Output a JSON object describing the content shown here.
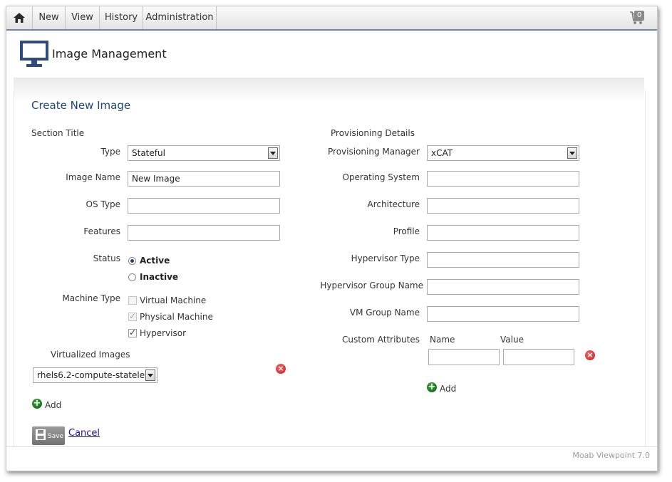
{
  "nav": {
    "items": [
      "New",
      "View",
      "History",
      "Administration"
    ],
    "cart_count": "0"
  },
  "header": {
    "title": "Image Management"
  },
  "form": {
    "title": "Create New Image",
    "left_section_title": "Section Title",
    "type_label": "Type",
    "type_value": "Stateful",
    "image_name_label": "Image Name",
    "image_name_value": "New Image",
    "os_type_label": "OS Type",
    "os_type_value": "",
    "features_label": "Features",
    "features_value": "",
    "status_label": "Status",
    "status_active": "Active",
    "status_inactive": "Inactive",
    "machine_type_label": "Machine Type",
    "machine_virtual": "Virtual Machine",
    "machine_physical": "Physical Machine",
    "machine_hypervisor": "Hypervisor",
    "virtualized_images_label": "Virtualized Images",
    "virtualized_image_value": "rhels6.2-compute-statele:",
    "add_label": "Add",
    "right_section_title": "Provisioning Details",
    "prov_manager_label": "Provisioning Manager",
    "prov_manager_value": "xCAT",
    "os_label": "Operating System",
    "arch_label": "Architecture",
    "profile_label": "Profile",
    "hypervisor_type_label": "Hypervisor Type",
    "hypervisor_group_label": "Hypervisor Group Name",
    "vm_group_label": "VM Group Name",
    "custom_attr_label": "Custom Attributes",
    "attr_name_header": "Name",
    "attr_value_header": "Value",
    "save_label": "Save",
    "cancel_label": "Cancel"
  },
  "footer": {
    "text": "Moab Viewpoint 7.0"
  },
  "colors": {
    "nav_accent": "#6d87b3",
    "title_blue": "#1d4579",
    "remove_red": "#c8181e",
    "add_green": "#0c5c0c"
  }
}
